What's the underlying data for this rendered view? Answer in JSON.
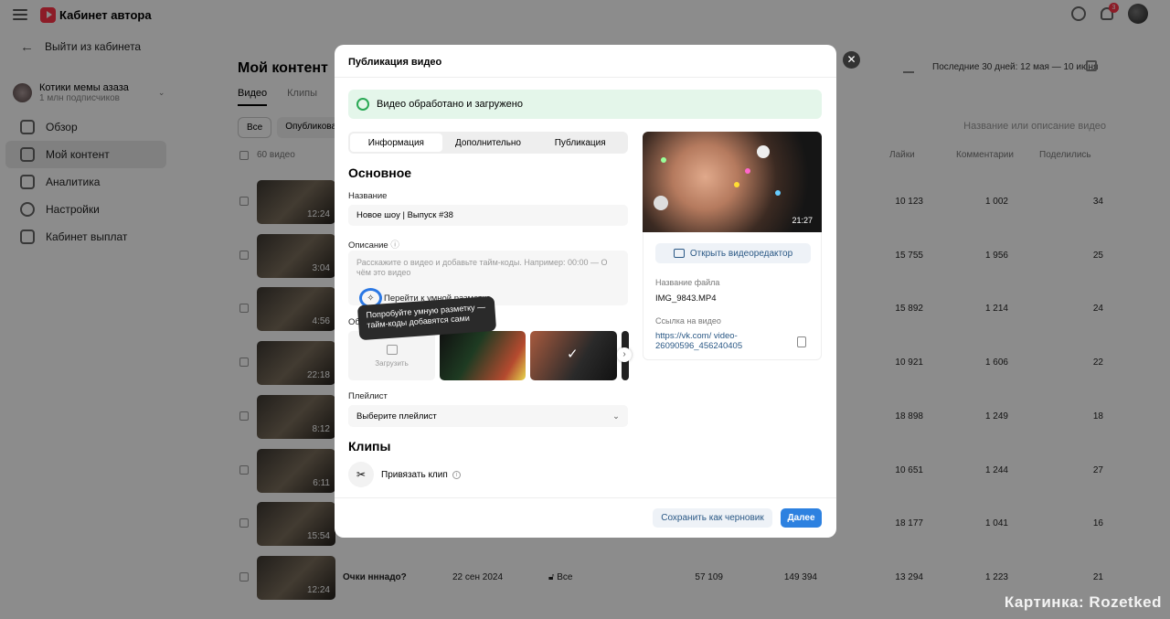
{
  "header": {
    "brand": "Кабинет автора",
    "notif_count": "3"
  },
  "sidebar": {
    "exit_label": "Выйти из кабинета",
    "channel_name": "Котики мемы азаза",
    "channel_subs": "1 млн подписчиков",
    "items": [
      {
        "label": "Обзор",
        "icon": "overview-icon"
      },
      {
        "label": "Мой контент",
        "icon": "content-icon"
      },
      {
        "label": "Аналитика",
        "icon": "analytics-icon"
      },
      {
        "label": "Настройки",
        "icon": "gear-icon"
      },
      {
        "label": "Кабинет выплат",
        "icon": "wallet-icon"
      }
    ]
  },
  "main": {
    "title": "Мой контент",
    "tabs": [
      "Видео",
      "Клипы"
    ],
    "filters": [
      "Все",
      "Опубликованн"
    ],
    "period": "Последние 30 дней: 12 мая — 10 июня",
    "search_placeholder": "Название или описание видео",
    "table_headers": {
      "count": "60 видео",
      "likes": "Лайки",
      "comments": "Комментарии",
      "shares": "Поделились"
    },
    "rows": [
      {
        "dur": "12:24",
        "likes": "10 123",
        "comments": "1 002",
        "shares": "34"
      },
      {
        "dur": "3:04",
        "likes": "15 755",
        "comments": "1 956",
        "shares": "25"
      },
      {
        "dur": "4:56",
        "likes": "15 892",
        "comments": "1 214",
        "shares": "24"
      },
      {
        "dur": "22:18",
        "likes": "10 921",
        "comments": "1 606",
        "shares": "22"
      },
      {
        "dur": "8:12",
        "likes": "18 898",
        "comments": "1 249",
        "shares": "18"
      },
      {
        "dur": "6:11",
        "likes": "10 651",
        "comments": "1 244",
        "shares": "27"
      },
      {
        "dur": "15:54",
        "likes": "18 177",
        "comments": "1 041",
        "shares": "16"
      },
      {
        "dur": "12:24",
        "title": "Очки нннадо?",
        "date": "22 сен 2024",
        "access": "Все",
        "views": "57 109",
        "reach": "149 394",
        "likes": "13 294",
        "comments": "1 223",
        "shares": "21"
      }
    ]
  },
  "modal": {
    "title": "Публикация видео",
    "success": "Видео обработано и загружено",
    "tabs": [
      "Информация",
      "Дополнительно",
      "Публикация"
    ],
    "section_main": "Основное",
    "name_label": "Название",
    "name_value": "Новое шоу | Выпуск #38",
    "desc_label": "Описание",
    "desc_placeholder": "Расскажите о видео и добавьте тайм-коды. Например: 00:00 — О чём это видео",
    "smart_markup": "Перейти к умной разметке",
    "tooltip": "Попробуйте умную разметку — тайм-коды добавятся сами",
    "cover_label": "Об",
    "upload_label": "Загрузить",
    "playlist_label": "Плейлист",
    "playlist_value": "Выберите плейлист",
    "section_clips": "Клипы",
    "attach_clip": "Привязать клип",
    "preview_duration": "21:27",
    "editor_button": "Открыть видеоредактор",
    "file_label": "Название файла",
    "file_value": "IMG_9843.MP4",
    "link_label": "Ссылка на видео",
    "link_value": "https://vk.com/ video-26090596_456240405",
    "draft_button": "Сохранить как черновик",
    "next_button": "Далее"
  },
  "watermark": "Картинка: Rozetked"
}
